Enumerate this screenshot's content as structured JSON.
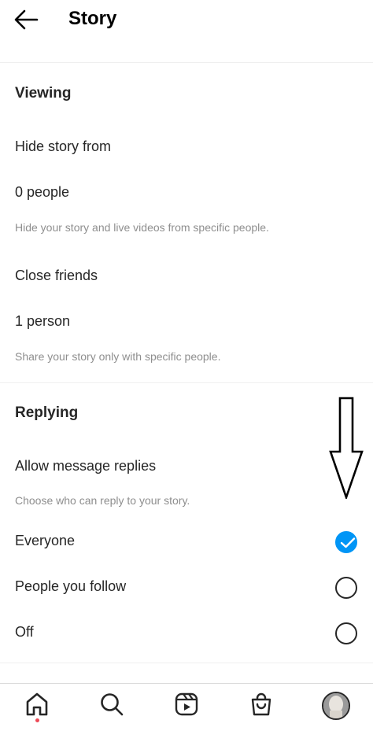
{
  "header": {
    "title": "Story",
    "back_icon": "arrow-left-icon"
  },
  "viewing": {
    "section_title": "Viewing",
    "hide_story": {
      "title": "Hide story from",
      "value": "0 people",
      "help": "Hide your story and live videos from specific people."
    },
    "close_friends": {
      "title": "Close friends",
      "value": "1 person",
      "help": "Share your story only with specific people."
    }
  },
  "replying": {
    "section_title": "Replying",
    "allow_replies": {
      "title": "Allow message replies",
      "help": "Choose who can reply to your story.",
      "options": [
        {
          "label": "Everyone",
          "checked": true
        },
        {
          "label": "People you follow",
          "checked": false
        },
        {
          "label": "Off",
          "checked": false
        }
      ],
      "selected": "Everyone"
    }
  },
  "tabbar": {
    "items": [
      "home-icon",
      "search-icon",
      "reels-icon",
      "shop-icon",
      "profile-avatar"
    ],
    "active": "home-icon"
  },
  "colors": {
    "accent": "#0095f6",
    "text": "#262626",
    "secondary_text": "#8e8e8e",
    "notification_dot": "#ed4956"
  }
}
